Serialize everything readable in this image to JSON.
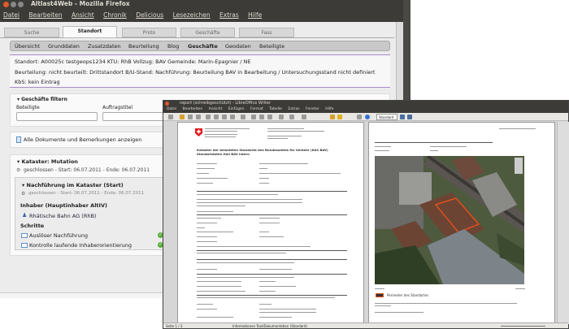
{
  "firefox": {
    "title": "Altlast4Web - Mozilla Firefox",
    "menu": [
      "Datei",
      "Bearbeiten",
      "Ansicht",
      "Chronik",
      "Delicious",
      "Lesezeichen",
      "Extras",
      "Hilfe"
    ],
    "main_tabs": [
      "Suche",
      "Standort",
      "Proto",
      "Geschäfte",
      "Fass"
    ],
    "active_main_tab": "Standort",
    "sub_tabs": [
      "Übersicht",
      "Grunddaten",
      "Zusatzdaten",
      "Beurteilung",
      "Blog",
      "Geschäfte",
      "Geodaten",
      "Beteiligte"
    ],
    "active_sub_tab": "Geschäfte",
    "info": {
      "line1": "Standort: A00025c testgeops1234    KTU: RhB    Vollzug: BAV    Gemeinde: Marin-Epagnier / NE",
      "line2": "Beurteilung: nicht beurteilt: Drittstandort    B/U-Stand: Nachführung: Beurteilung BAV in Bearbeitung / Untersuchungsstand nicht definiert",
      "line3": "KbS: kein Eintrag"
    },
    "filter": {
      "heading": "▾ Geschäfte filtern",
      "label1": "Beteiligte",
      "label2": "Auftragstitel",
      "value1": "",
      "value2": ""
    },
    "documents_link": "Alle Dokumente und Bemerkungen anzeigen",
    "kataster": {
      "heading": "▾ Kataster: Mutation",
      "status": "geschlossen - Start: 06.07.2011 - Ende: 06.07.2011",
      "sub_heading": "▾ Nachführung im Kataster (Start)",
      "sub_status": "geschlossen - Start: 06.07.2011 - Ende: 06.07.2011",
      "owner_label": "Inhaber (Hauptinhaber AltIV)",
      "owner": "Rhätische Bahn AG (RhB)",
      "steps_label": "Schritte",
      "steps": [
        "Auslöser Nachführung",
        "Kontrolle laufende Inhaberorientierung"
      ]
    }
  },
  "writer": {
    "title": "report (schreibgeschützt) - LibreOffice Writer",
    "menu": [
      "Datei",
      "Bearbeiten",
      "Ansicht",
      "Einfügen",
      "Format",
      "Tabelle",
      "Extras",
      "Fenster",
      "Hilfe"
    ],
    "zoom_select": "Standard",
    "page1": {
      "heading": "Kataster der belasteten Standorte des Bundesamtes für Verkehr (KbS BAV)",
      "subheading": "Standortdaten Hall BAV intern"
    },
    "page2": {
      "legend_item": "Perimeter des Standortes"
    },
    "status": {
      "page": "Seite 1 / 3",
      "style": "Informationen Tool/Dokumentation (Standard)"
    }
  },
  "colors": {
    "accent_purple": "#a98bc9",
    "titlebar": "#3c3b37",
    "check_green": "#5cae3d",
    "swiss_red": "#e3161b",
    "perimeter": "#e0501a"
  }
}
